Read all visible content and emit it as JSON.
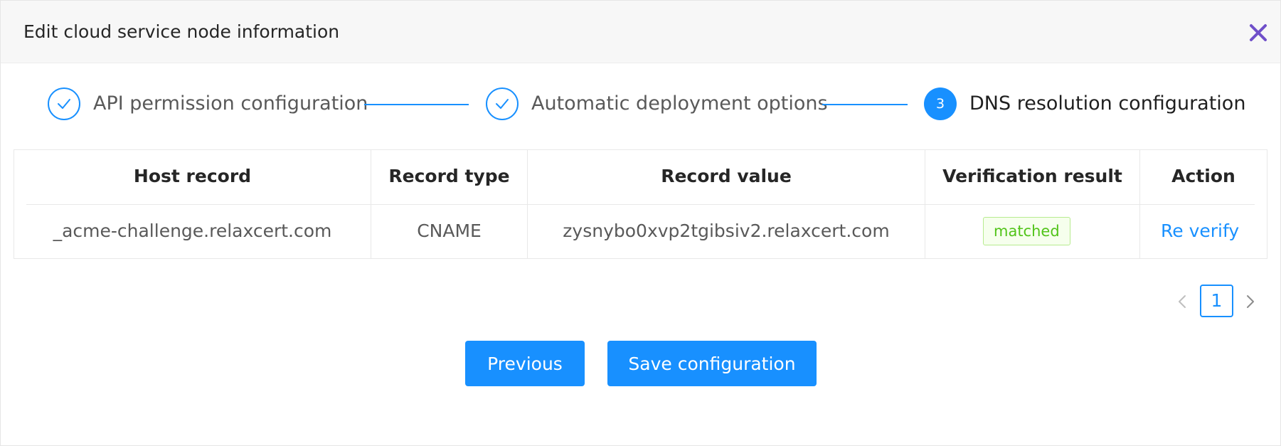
{
  "modal": {
    "title": "Edit cloud service node information"
  },
  "steps": [
    {
      "label": "API permission configuration",
      "status": "done"
    },
    {
      "label": "Automatic deployment options",
      "status": "done"
    },
    {
      "label": "DNS resolution configuration",
      "status": "active",
      "number": "3"
    }
  ],
  "table": {
    "columns": [
      "Host record",
      "Record type",
      "Record value",
      "Verification result",
      "Action"
    ],
    "rows": [
      {
        "host": "_acme-challenge.relaxcert.com",
        "type": "CNAME",
        "value": "zysnybo0xvp2tgibsiv2.relaxcert.com",
        "result": "matched",
        "action": "Re verify"
      }
    ]
  },
  "pagination": {
    "current_page": "1"
  },
  "buttons": {
    "previous": "Previous",
    "save": "Save configuration"
  },
  "icons": {
    "close": "close-icon",
    "check": "check-icon",
    "prev": "chevron-left-icon",
    "next": "chevron-right-icon"
  },
  "colors": {
    "accent": "#1890ff",
    "close_icon": "#6f4fc9",
    "success": "#52c41a",
    "success_bg": "#f6ffed",
    "success_border": "#b7eb8f",
    "header_bg": "#f7f7f7"
  }
}
